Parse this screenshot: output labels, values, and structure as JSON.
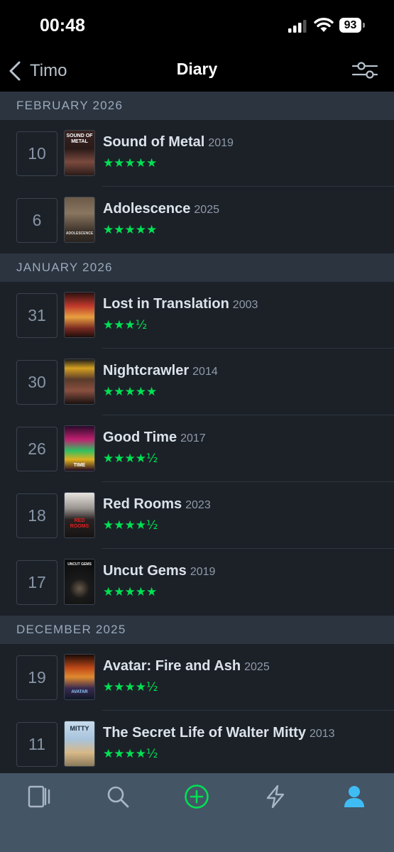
{
  "status": {
    "time": "00:48",
    "battery": "93"
  },
  "nav": {
    "back_label": "Timo",
    "title": "Diary"
  },
  "colors": {
    "star": "#00e054",
    "active_tab": "#40bcf4",
    "add_button": "#00e054"
  },
  "sections": [
    {
      "header": "FEBRUARY 2026",
      "entries": [
        {
          "day": "10",
          "title": "Sound of Metal",
          "year": "2019",
          "rating": "★★★★★",
          "poster_text": "SOUND OF METAL"
        },
        {
          "day": "6",
          "title": "Adolescence",
          "year": "2025",
          "rating": "★★★★★",
          "poster_text": "ADOLESCENCE"
        }
      ]
    },
    {
      "header": "JANUARY 2026",
      "entries": [
        {
          "day": "31",
          "title": "Lost in Translation",
          "year": "2003",
          "rating": "★★★½"
        },
        {
          "day": "30",
          "title": "Nightcrawler",
          "year": "2014",
          "rating": "★★★★★"
        },
        {
          "day": "26",
          "title": "Good Time",
          "year": "2017",
          "rating": "★★★★½",
          "poster_text": "TIME"
        },
        {
          "day": "18",
          "title": "Red Rooms",
          "year": "2023",
          "rating": "★★★★½",
          "poster_text": "RED ROOMS"
        },
        {
          "day": "17",
          "title": "Uncut Gems",
          "year": "2019",
          "rating": "★★★★★",
          "poster_text": "UNCUT GEMS"
        }
      ]
    },
    {
      "header": "DECEMBER 2025",
      "entries": [
        {
          "day": "19",
          "title": "Avatar: Fire and Ash",
          "year": "2025",
          "rating": "★★★★½",
          "poster_text": "AVATAR"
        },
        {
          "day": "11",
          "title": "The Secret Life of Walter Mitty",
          "year": "2013",
          "rating": "★★★★½",
          "poster_text": "MITTY"
        }
      ]
    }
  ],
  "tabs": [
    {
      "icon": "films-icon"
    },
    {
      "icon": "search-icon"
    },
    {
      "icon": "add-icon"
    },
    {
      "icon": "activity-icon"
    },
    {
      "icon": "profile-icon"
    }
  ]
}
